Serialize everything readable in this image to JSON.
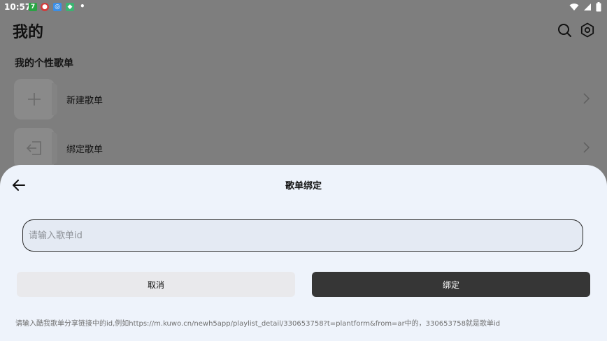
{
  "status_bar": {
    "time": "10:57",
    "icons": [
      {
        "name": "app-7-icon",
        "glyph": "7",
        "color": "#2aa344"
      },
      {
        "name": "app-red-icon",
        "glyph": "●",
        "color": "#d23a3a"
      },
      {
        "name": "app-blue-icon",
        "glyph": "◎",
        "color": "#3a8ee6"
      },
      {
        "name": "app-green-icon",
        "glyph": "◆",
        "color": "#3cb371"
      }
    ],
    "dot": "•"
  },
  "header": {
    "title": "我的"
  },
  "section": {
    "title": "我的个性歌单"
  },
  "list": {
    "items": [
      {
        "label": "新建歌单"
      },
      {
        "label": "绑定歌单"
      }
    ]
  },
  "dialog": {
    "title": "歌单绑定",
    "input_value": "",
    "input_placeholder": "请输入歌单id",
    "cancel_label": "取消",
    "bind_label": "绑定",
    "hint": "请输入酷我歌单分享链接中的id,例如https://m.kuwo.cn/newh5app/playlist_detail/330653758?t=plantform&from=ar中的，330653758就是歌单id"
  },
  "colors": {
    "overlay": "#7e7e7e",
    "sheet": "#eef3fb",
    "primary_button": "#363636",
    "secondary_button": "#e9e9ec"
  }
}
